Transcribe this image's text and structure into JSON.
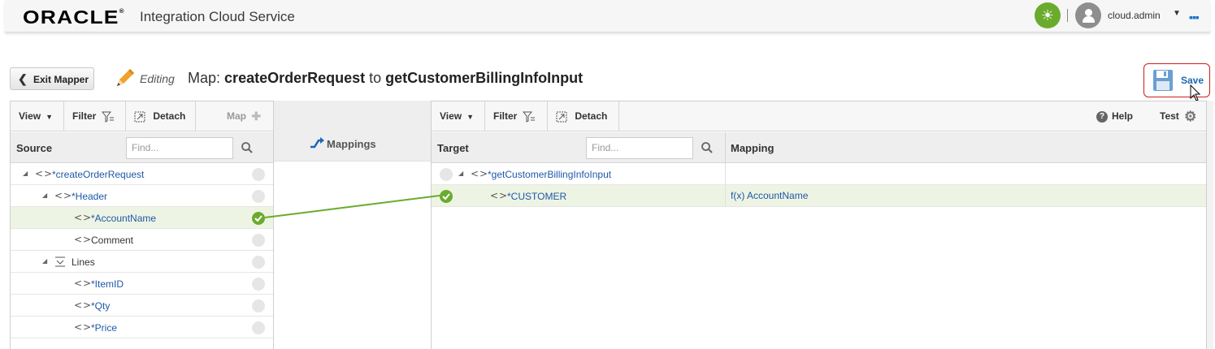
{
  "header": {
    "logo": "ORACLE",
    "app_title": "Integration Cloud Service",
    "user": "cloud.admin",
    "status_icon": "sun-icon",
    "user_menu_icon": "caret-down-icon",
    "more_icon": "dots-icon"
  },
  "editor": {
    "exit_label": "Exit Mapper",
    "mode_label": "Editing",
    "map_prefix": "Map:",
    "source_name": "createOrderRequest",
    "connector": "to",
    "target_name": "getCustomerBillingInfoInput",
    "save_label": "Save"
  },
  "source": {
    "toolbar": {
      "view": "View",
      "filter": "Filter",
      "detach": "Detach",
      "map": "Map"
    },
    "column": "Source",
    "find_placeholder": "Find...",
    "rows": [
      {
        "name": "*createOrderRequest",
        "mapped": false
      },
      {
        "name": "*Header",
        "mapped": false
      },
      {
        "name": "*AccountName",
        "mapped": true
      },
      {
        "name": "Comment",
        "mapped": false
      },
      {
        "name": "Lines",
        "mapped": false
      },
      {
        "name": "*ItemID",
        "mapped": false
      },
      {
        "name": "*Qty",
        "mapped": false
      },
      {
        "name": "*Price",
        "mapped": false
      }
    ]
  },
  "middle": {
    "mappings_label": "Mappings"
  },
  "target": {
    "toolbar": {
      "view": "View",
      "filter": "Filter",
      "detach": "Detach",
      "help": "Help",
      "test": "Test"
    },
    "column": "Target",
    "mapping_column": "Mapping",
    "find_placeholder": "Find...",
    "rows": [
      {
        "name": "*getCustomerBillingInfoInput",
        "mapping": ""
      },
      {
        "name": "*CUSTOMER",
        "mapping": "f(x) AccountName"
      }
    ]
  },
  "colors": {
    "accent": "#1a67b8",
    "mapped_green": "#6aab2e",
    "save_highlight": "#d01c1c"
  }
}
